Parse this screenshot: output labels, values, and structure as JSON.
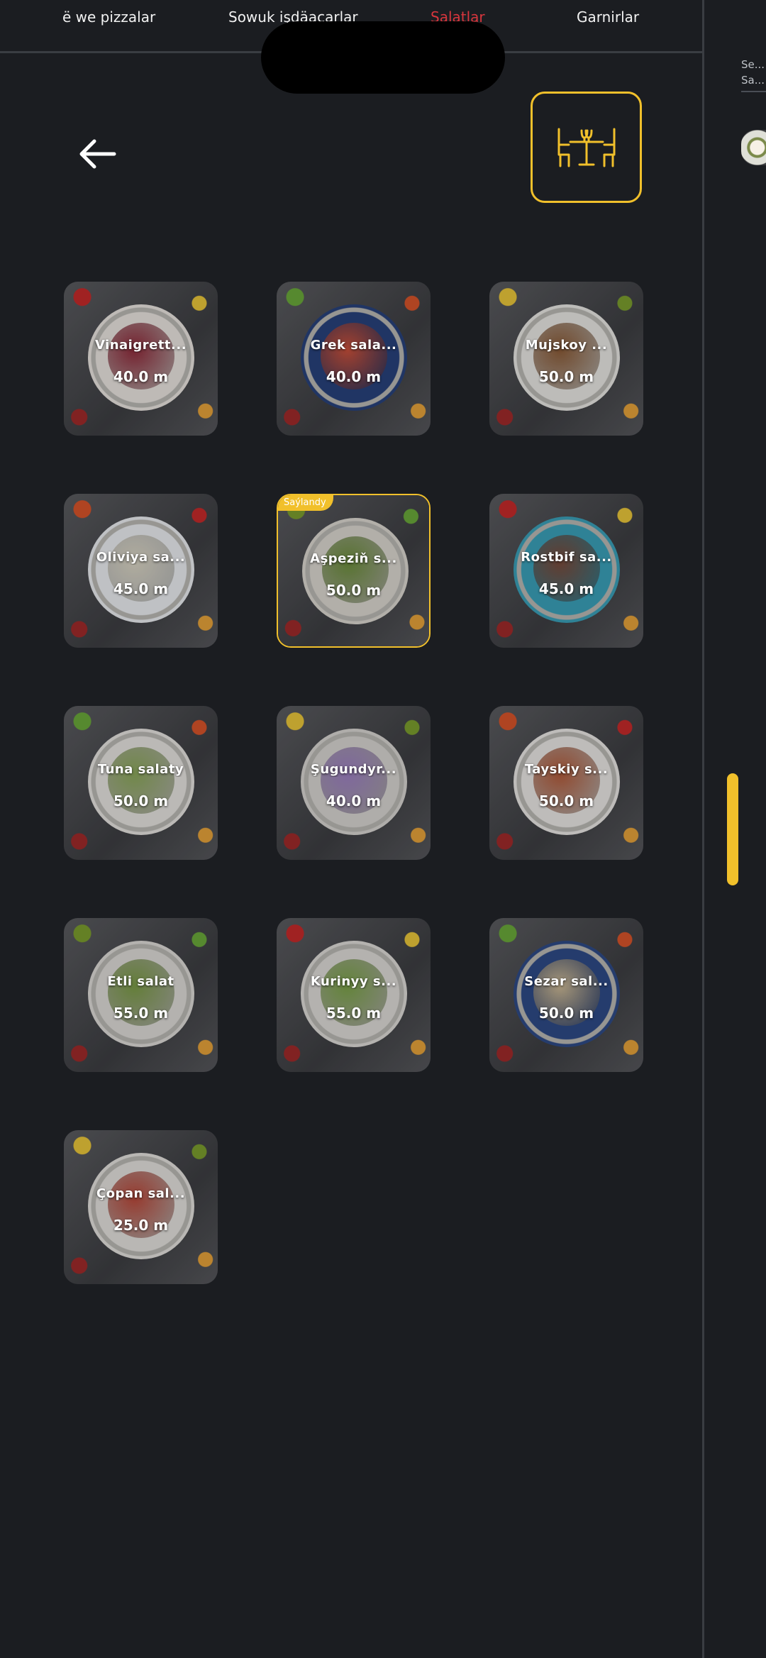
{
  "tabs": [
    {
      "label": "ë we pizzalar",
      "active": false
    },
    {
      "label": "Sowuk işdäaçarlar",
      "active": false
    },
    {
      "label": "Salatlar",
      "active": true
    },
    {
      "label": "Garnirlar",
      "active": false
    }
  ],
  "side_panel": {
    "line1": "Se...",
    "line2": "Sa..."
  },
  "icons": {
    "back": "arrow-left-icon",
    "table": "restaurant-table-icon"
  },
  "colors": {
    "accent": "#f1c02b",
    "active_tab": "#d8363d",
    "background": "#1b1d21"
  },
  "products": [
    {
      "name": "Vinaigrett...",
      "price": "40.0 m",
      "badge": "",
      "plate": "#e8e3df",
      "food": "#8e2a3a"
    },
    {
      "name": "Grek sala...",
      "price": "40.0 m",
      "badge": "",
      "plate": "#28417a",
      "food": "#c9503a"
    },
    {
      "name": "Mujskoy ...",
      "price": "50.0 m",
      "badge": "",
      "plate": "#e7e6e2",
      "food": "#8a5a36"
    },
    {
      "name": "Oliviya sa...",
      "price": "45.0 m",
      "badge": "",
      "plate": "#e9ecef",
      "food": "#d8d3c2"
    },
    {
      "name": "Aşpeziň s...",
      "price": "50.0 m",
      "badge": "Saýlandy",
      "plate": "#d9d6cf",
      "food": "#6c8d3c"
    },
    {
      "name": "Rostbif sa...",
      "price": "45.0 m",
      "badge": "",
      "plate": "#3a9fb8",
      "food": "#7a4a3a"
    },
    {
      "name": "Tuna salaty",
      "price": "50.0 m",
      "badge": "",
      "plate": "#e4e2de",
      "food": "#8aa65a"
    },
    {
      "name": "Şugundyr...",
      "price": "40.0 m",
      "badge": "",
      "plate": "#d6d4d0",
      "food": "#9c7fc0"
    },
    {
      "name": "Tayskiy s...",
      "price": "50.0 m",
      "badge": "",
      "plate": "#e8e6e3",
      "food": "#b05a3a"
    },
    {
      "name": "Etli salat",
      "price": "55.0 m",
      "badge": "",
      "plate": "#dcdad6",
      "food": "#7a9a46"
    },
    {
      "name": "Kurinyy s...",
      "price": "55.0 m",
      "badge": "",
      "plate": "#dcdad6",
      "food": "#7aa048"
    },
    {
      "name": "Sezar sal...",
      "price": "50.0 m",
      "badge": "",
      "plate": "#2e4a86",
      "food": "#cbb894"
    },
    {
      "name": "Çopan sal...",
      "price": "25.0 m",
      "badge": "",
      "plate": "#e2e0dc",
      "food": "#b8483a"
    }
  ]
}
